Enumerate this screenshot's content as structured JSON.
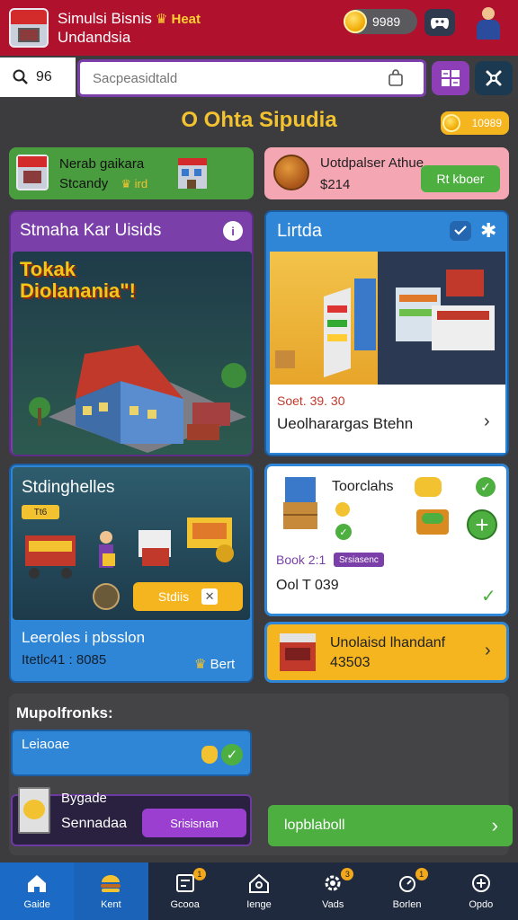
{
  "header": {
    "title_line1": "Simulsi Bisnis",
    "title_accent": "Heat",
    "title_line2": "Undandsia",
    "coins": "9989"
  },
  "search": {
    "left_text": "96",
    "placeholder": "Sacpeasidtald"
  },
  "section": {
    "title": "O Ohta Sipudia",
    "gold_value": "10989"
  },
  "promo_left": {
    "line1": "Nerab gaikara",
    "line2": "Stcandy",
    "tag": "ird"
  },
  "promo_right": {
    "line1": "Uotdpalser Athue",
    "line2": "$214",
    "button": "Rt kboer"
  },
  "card_city": {
    "title": "Stmaha Kar Uisids",
    "banner_line1": "Tokak",
    "banner_line2": "Diolanania\"!"
  },
  "card_store": {
    "title": "Lirtda",
    "price": "Soet. 39. 30",
    "subtitle": "Ueolharargas Btehn"
  },
  "card_shop": {
    "title": "Stdinghelles",
    "tag": "Tt6",
    "button": "Stdiis",
    "footer_line1": "Leeroles i pbsslon",
    "footer_line2": "Itetlc41 : 8085",
    "footer_action": "Bert"
  },
  "card_inventory": {
    "title": "Toorclahs",
    "price": "Book 2:1",
    "tag": "Srsiasenc",
    "code": "Ool T 039"
  },
  "card_upgrade": {
    "line1": "Unolaisd lhandanf",
    "line2": "43503"
  },
  "more": {
    "heading": "Mupolfronks:",
    "row1": "Leiaoae",
    "row2_label": "Bygade",
    "row2_name": "Sennadaa",
    "row2_button": "Srisisnan",
    "green_row": "lopblaboll"
  },
  "nav": [
    {
      "label": "Gaide",
      "icon": "home-icon",
      "badge": ""
    },
    {
      "label": "Kent",
      "icon": "burger-icon",
      "badge": ""
    },
    {
      "label": "Gcooa",
      "icon": "board-icon",
      "badge": "1"
    },
    {
      "label": "Ienge",
      "icon": "house-icon",
      "badge": ""
    },
    {
      "label": "Vads",
      "icon": "gear-icon",
      "badge": "3"
    },
    {
      "label": "Borlen",
      "icon": "timer-icon",
      "badge": "1"
    },
    {
      "label": "Opdo",
      "icon": "plus-icon",
      "badge": ""
    }
  ],
  "colors": {
    "header": "#b0112d",
    "purple": "#7a3fa8",
    "blue": "#2f86d6",
    "green": "#4caf3f",
    "gold": "#f5b51f"
  }
}
